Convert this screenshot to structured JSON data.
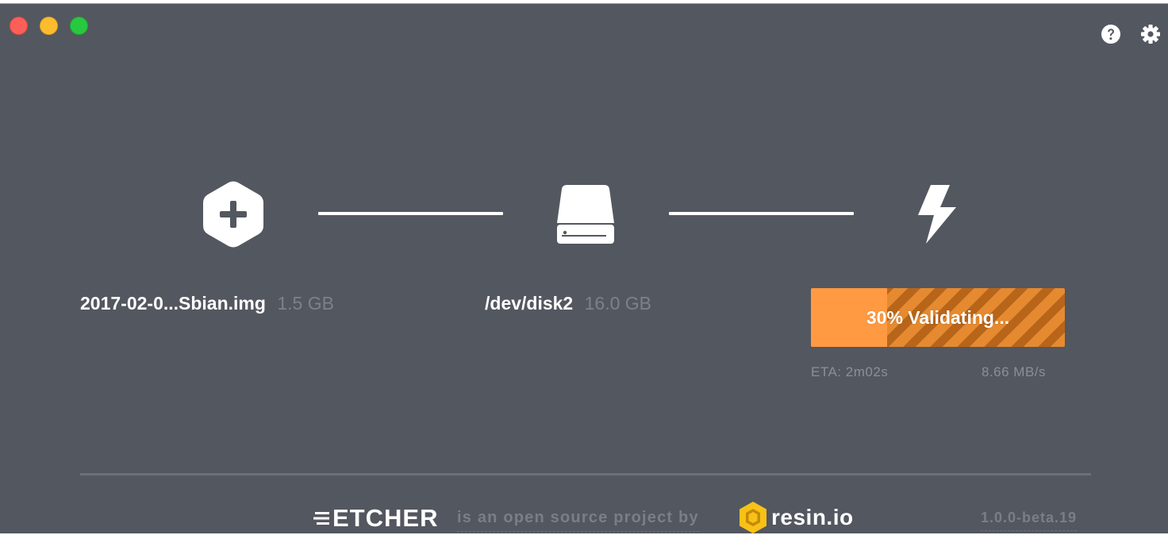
{
  "window": {
    "controls": [
      "close",
      "minimize",
      "maximize"
    ]
  },
  "header": {
    "help_icon": "question-circle",
    "settings_icon": "gear"
  },
  "steps": {
    "image": {
      "icon": "hexagon-plus",
      "name": "2017-02-0...Sbian.img",
      "size": "1.5 GB"
    },
    "drive": {
      "icon": "hard-drive",
      "name": "/dev/disk2",
      "size": "16.0 GB"
    },
    "flash": {
      "icon": "lightning-bolt",
      "progress_percent": 30,
      "progress_label": "30% Validating...",
      "eta": "ETA: 2m02s",
      "speed": "8.66 MB/s"
    }
  },
  "footer": {
    "brand": "ETCHER",
    "tagline": "is an open source project by",
    "partner": "resin.io",
    "version": "1.0.0-beta.19"
  },
  "colors": {
    "background": "#535760",
    "progress": "#ff9a42",
    "progress_stripe_dark": "#b8651a",
    "text_muted": "#7d818a"
  }
}
